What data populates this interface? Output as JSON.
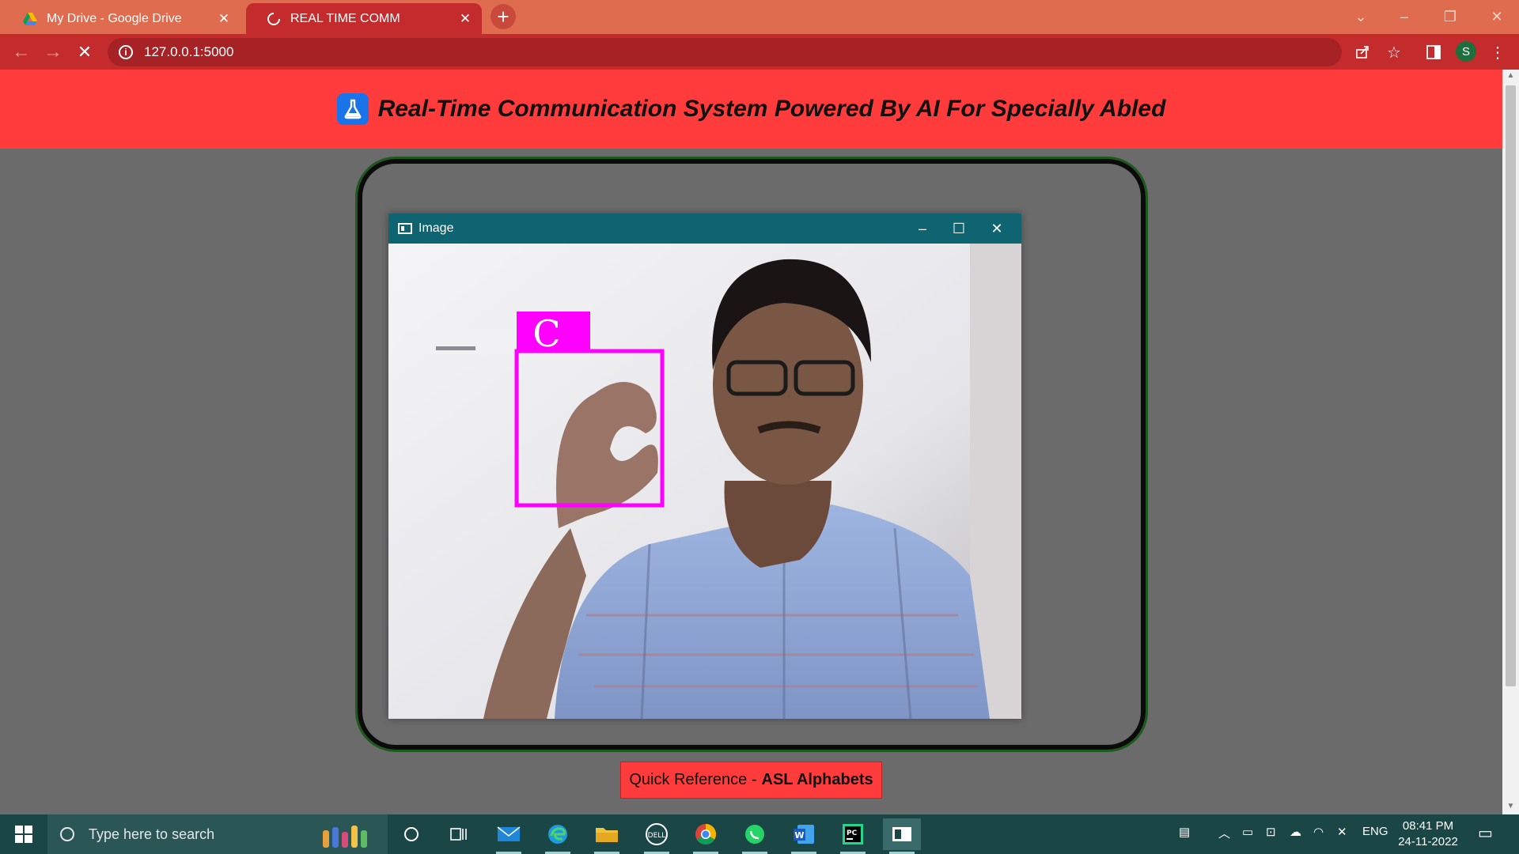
{
  "browser": {
    "tabs": [
      {
        "label": "My Drive - Google Drive",
        "favicon": "google-drive-icon",
        "active": false
      },
      {
        "label": "REAL TIME COMM",
        "favicon": "loading-spinner-icon",
        "active": true
      }
    ],
    "new_tab_symbol": "+",
    "close_symbol": "✕",
    "url": "127.0.0.1:5000",
    "profile_initial": "S",
    "tab_color": "#c42b2c",
    "frame_color": "#e06c50"
  },
  "page": {
    "title": "Real-Time Communication System Powered By AI For Specially Abled",
    "header_color": "#ff3b3b",
    "quick_ref_prefix": "Quick Reference - ",
    "quick_ref_bold": "ASL Alphabets"
  },
  "cv_window": {
    "title": "Image",
    "detected_letter": "C",
    "box_color": "#ff00ff",
    "titlebar_color": "#0e6470"
  },
  "taskbar": {
    "search_placeholder": "Type here to search",
    "language": "ENG",
    "time": "08:41 PM",
    "date": "24-11-2022",
    "apps": [
      "cortana-icon",
      "task-view-icon",
      "mail-icon",
      "edge-icon",
      "file-explorer-icon",
      "dell-icon",
      "chrome-icon",
      "whatsapp-icon",
      "word-icon",
      "pycharm-icon",
      "image-window-icon"
    ]
  }
}
